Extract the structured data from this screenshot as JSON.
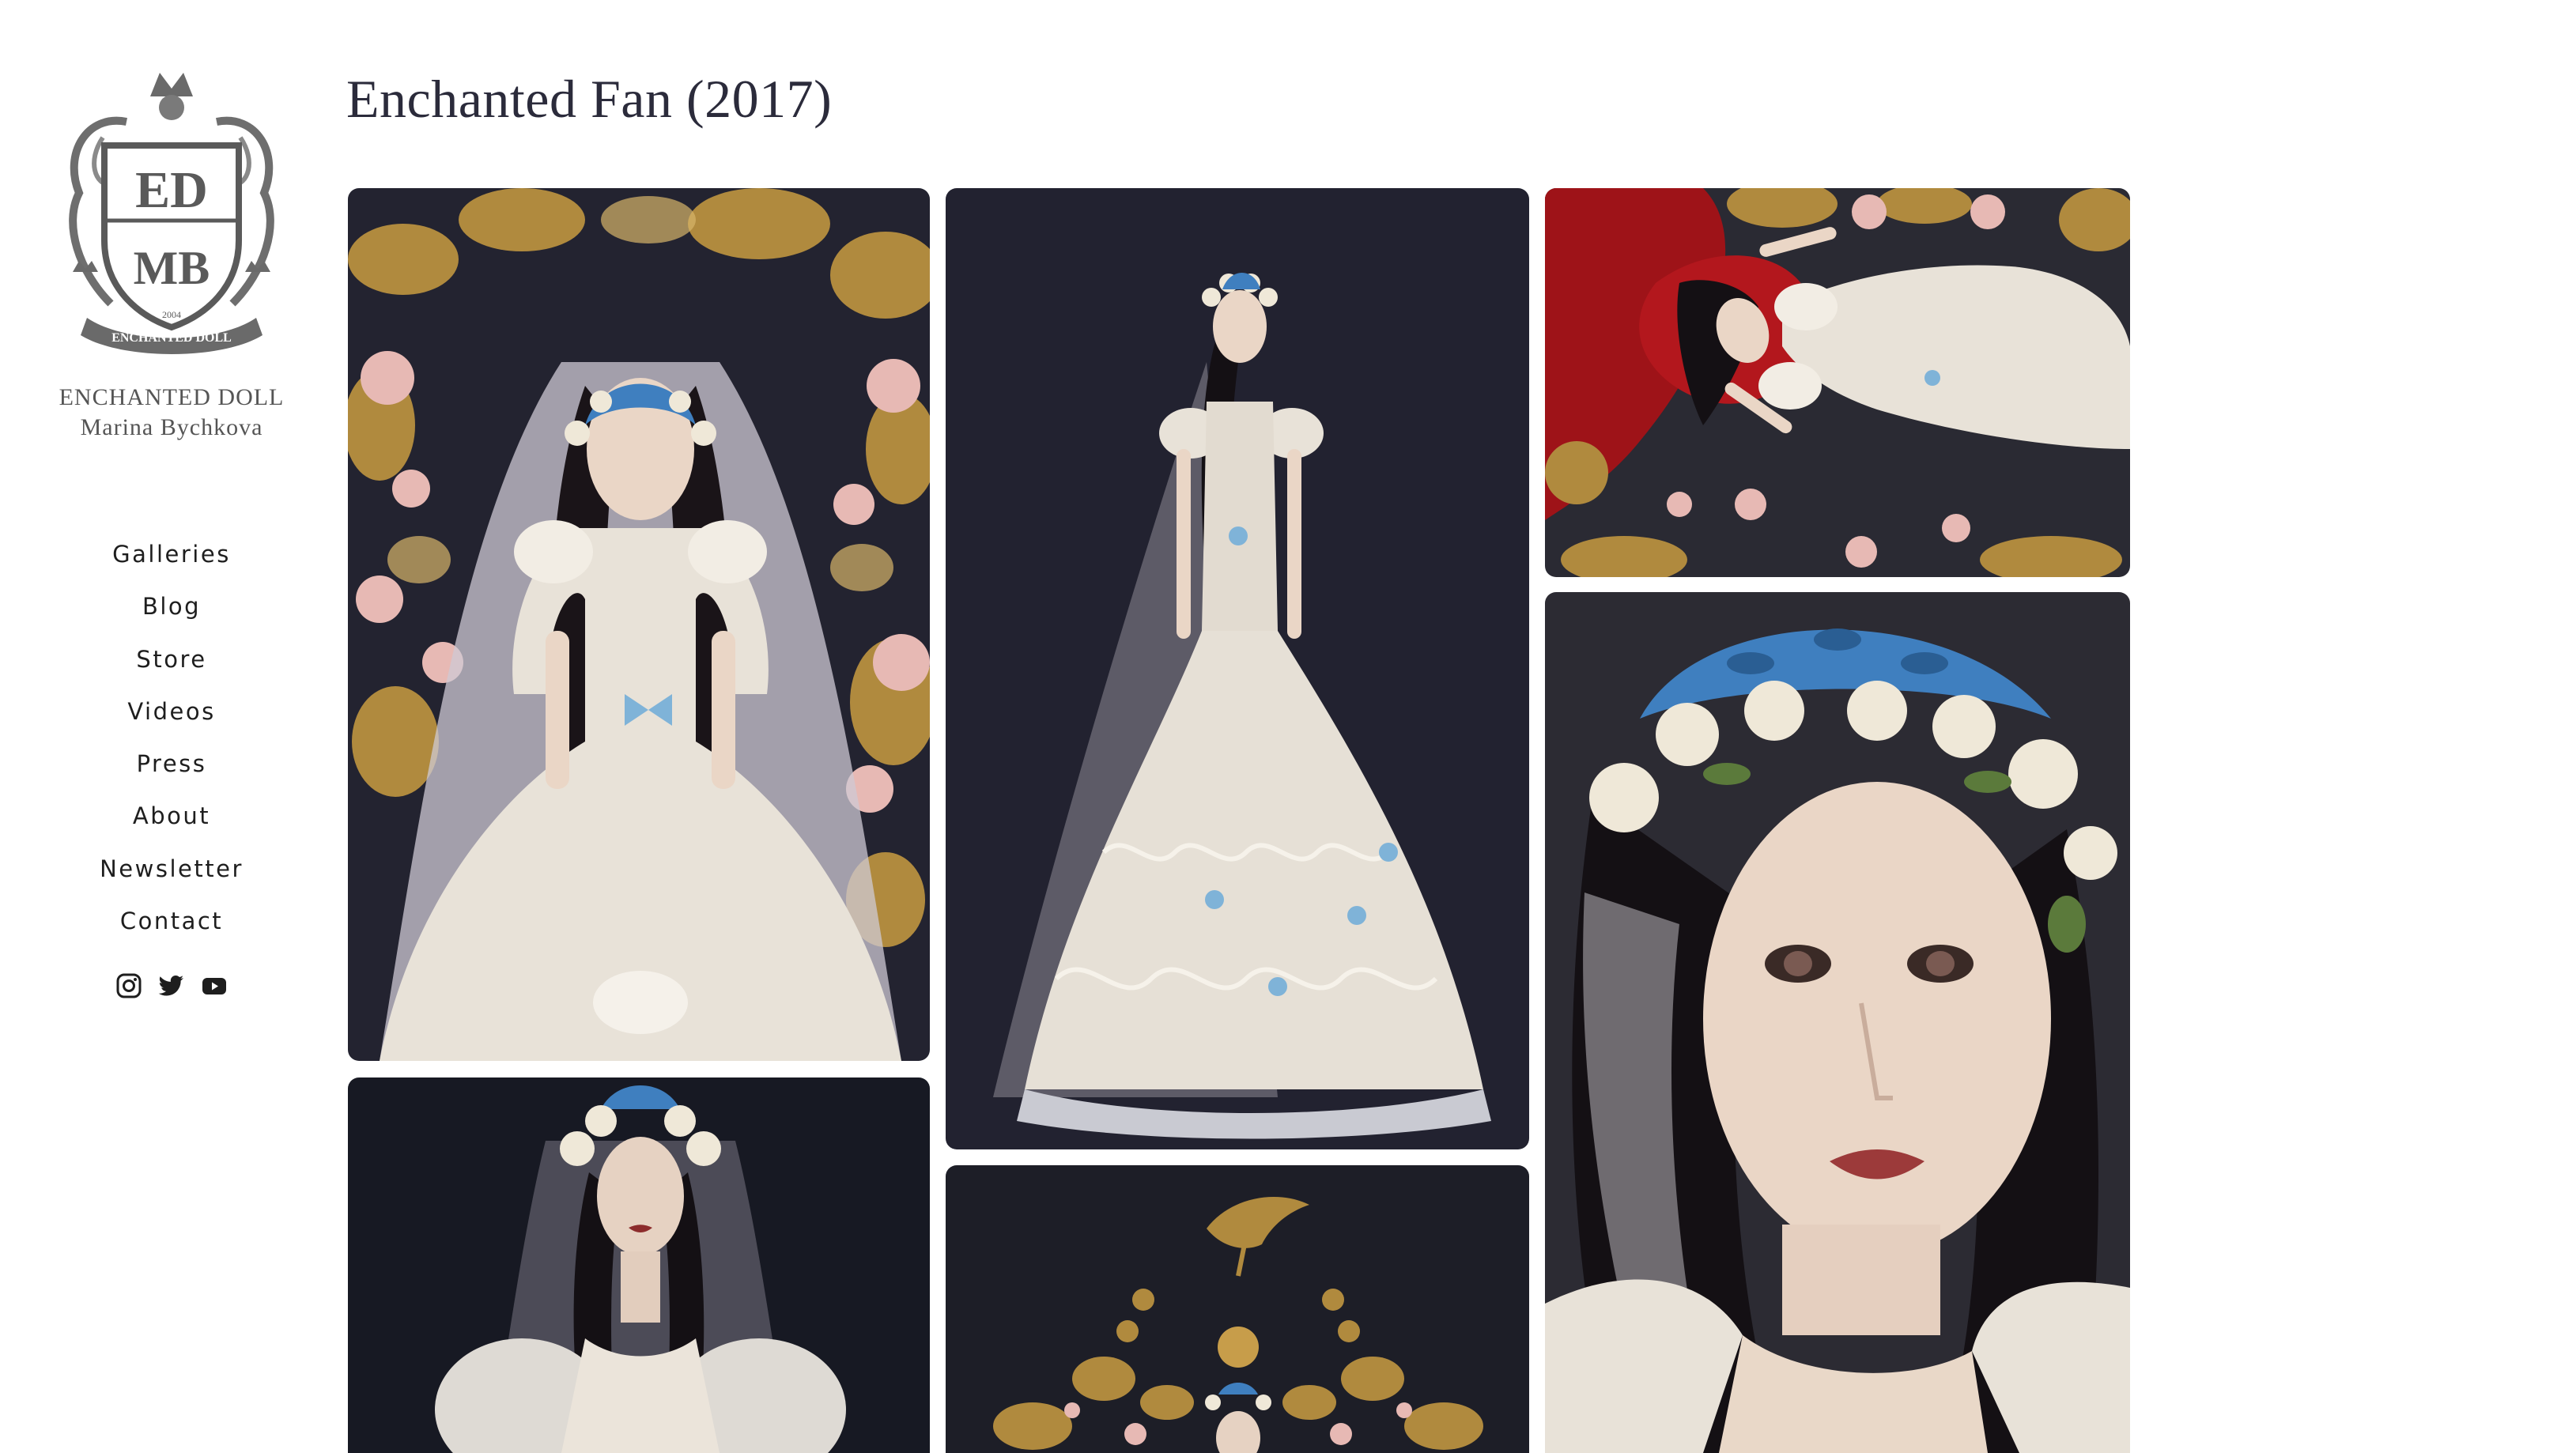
{
  "brand": {
    "line1": "ENCHANTED DOLL",
    "line2": "Marina Bychkova",
    "logo_monogram_top": "ED",
    "logo_monogram_bottom": "MB",
    "logo_year": "2004",
    "logo_banner": "ENCHANTED DOLL"
  },
  "nav": {
    "items": [
      {
        "label": "Galleries"
      },
      {
        "label": "Blog"
      },
      {
        "label": "Store"
      },
      {
        "label": "Videos"
      },
      {
        "label": "Press"
      },
      {
        "label": "About"
      },
      {
        "label": "Newsletter"
      },
      {
        "label": "Contact"
      }
    ]
  },
  "social": {
    "icons": [
      "instagram-icon",
      "twitter-icon",
      "youtube-icon"
    ]
  },
  "page": {
    "title": "Enchanted Fan (2017)"
  },
  "gallery": {
    "tiles": [
      {
        "subject": "doll-seated-with-golden-floral-background"
      },
      {
        "subject": "doll-full-length-in-lace-gown"
      },
      {
        "subject": "doll-lying-on-red-cushion"
      },
      {
        "subject": "doll-face-close-up"
      },
      {
        "subject": "doll-portrait-dark-background"
      },
      {
        "subject": "doll-with-golden-fan-headpiece"
      }
    ]
  },
  "colors": {
    "text": "#1e1e1e",
    "title": "#2b2b3b",
    "brand_gray": "#555555",
    "photo_dark": "#22222c",
    "gold": "#b08a3e",
    "rose": "#e7b9b4",
    "lace": "#e8e2d8",
    "velvet_red": "#9e1318",
    "ribbon_blue": "#7fb3d8"
  }
}
